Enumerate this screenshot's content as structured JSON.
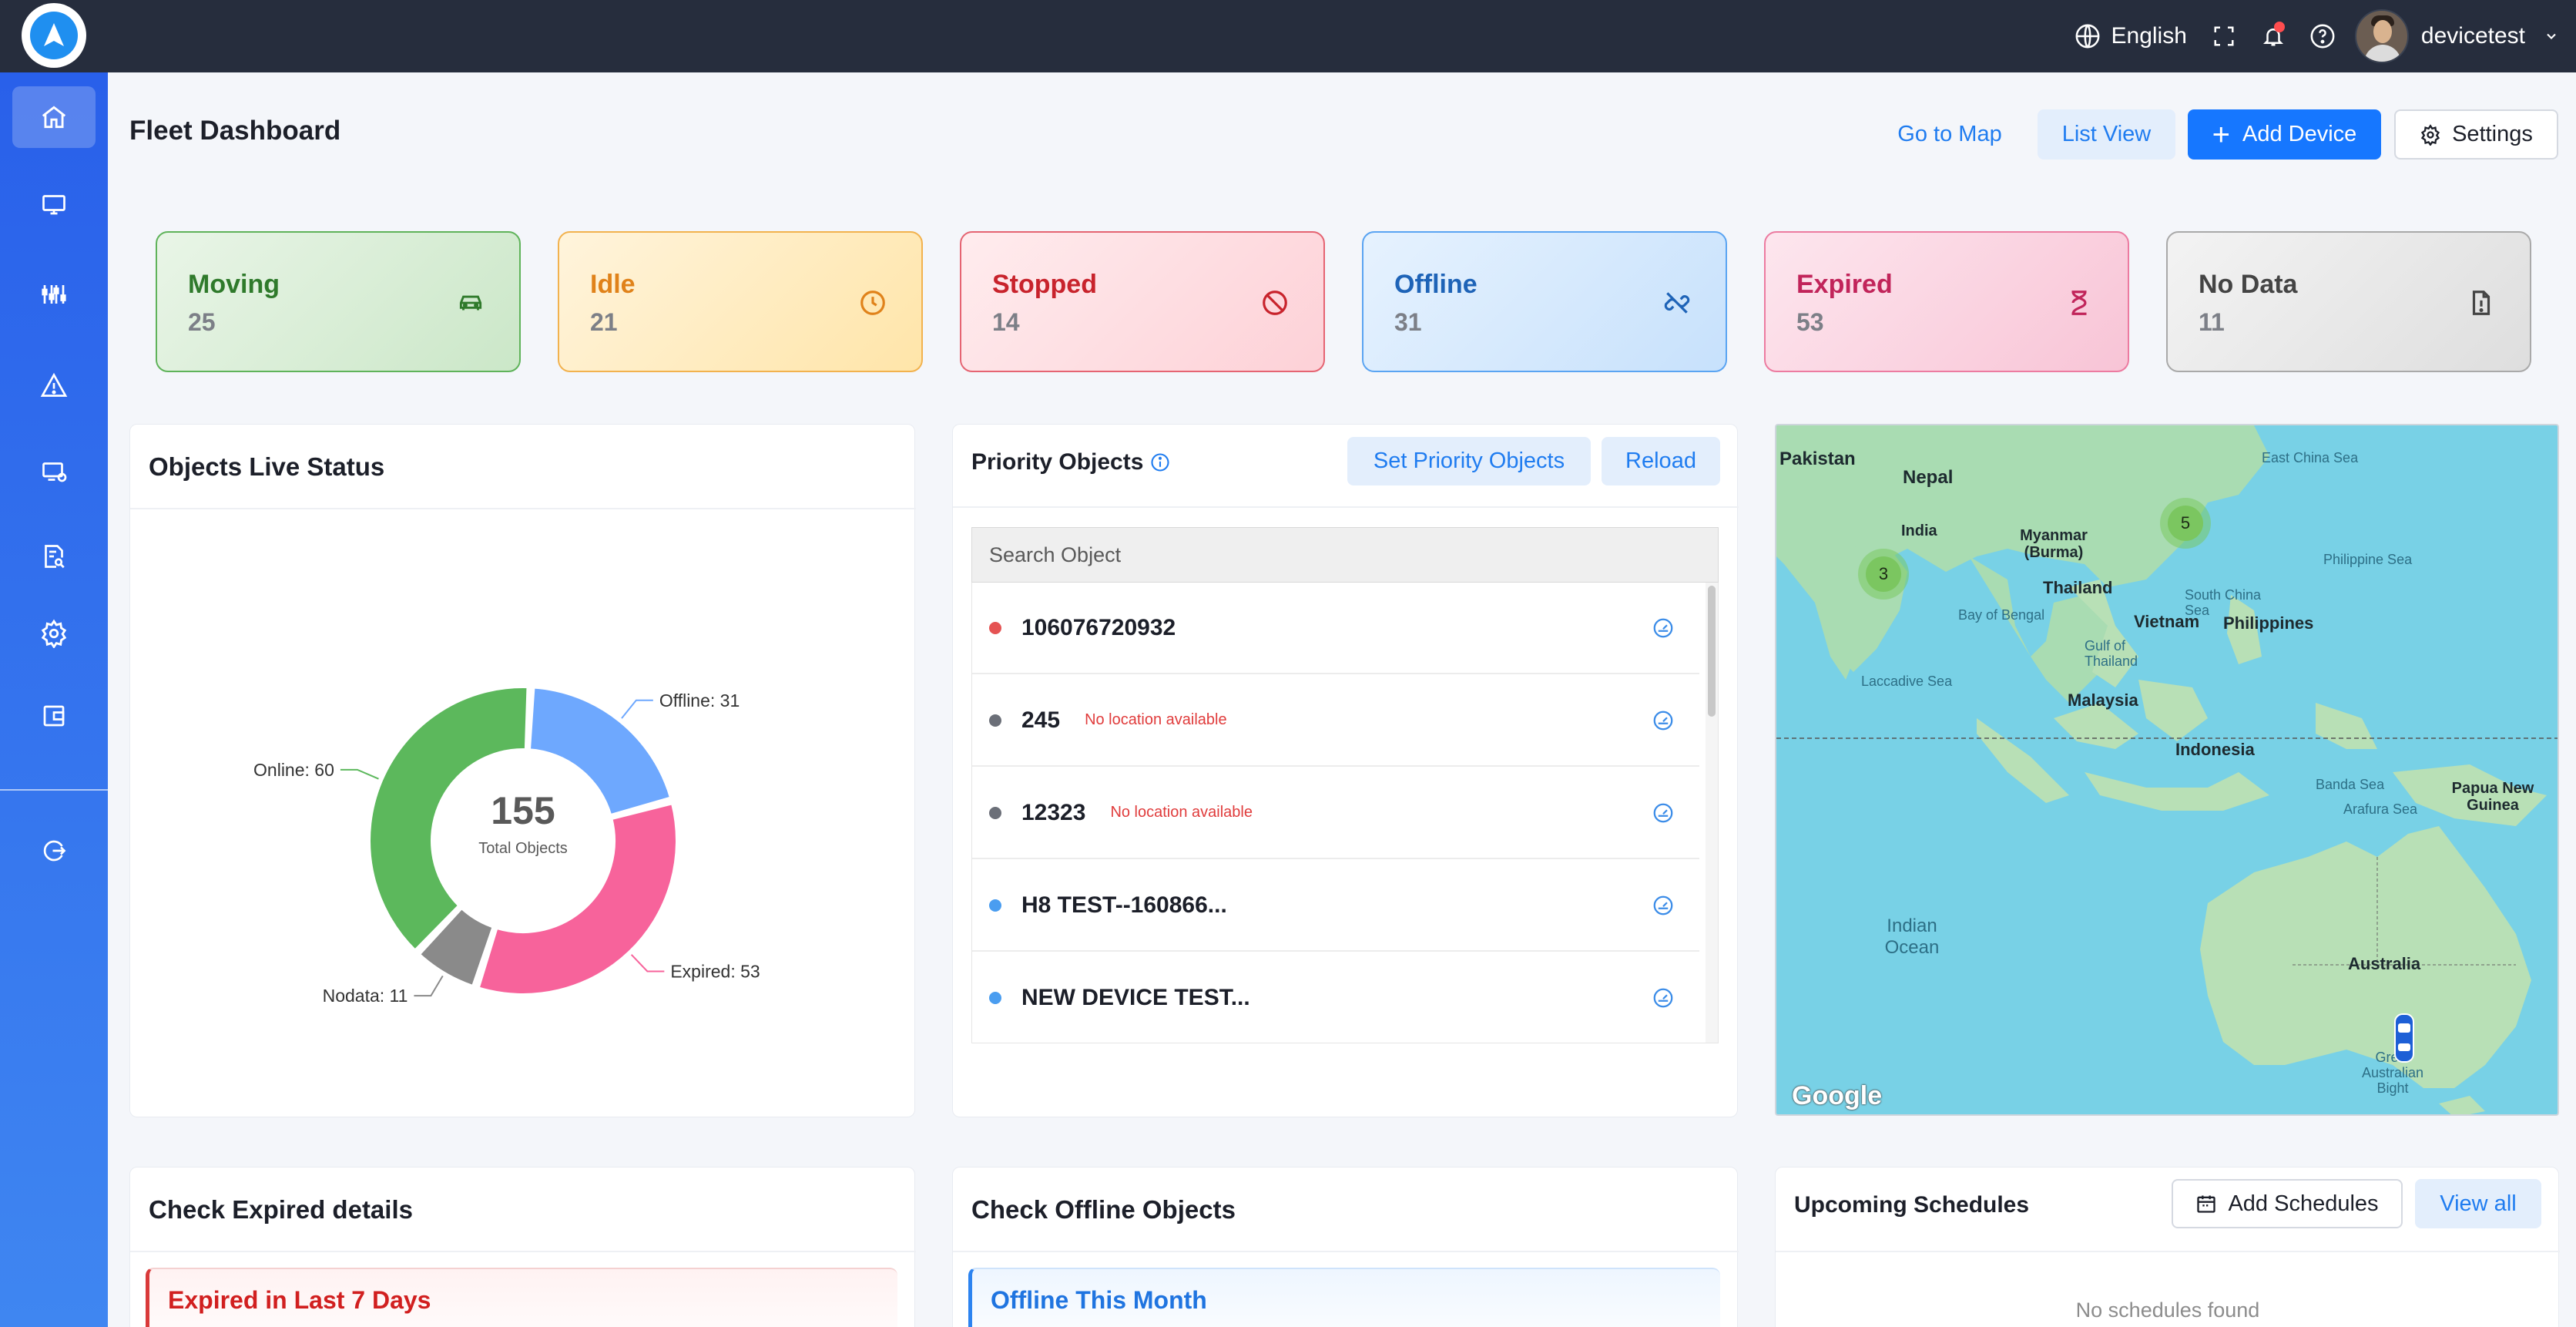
{
  "topbar": {
    "language": "English",
    "username": "devicetest"
  },
  "sidebar": {
    "items": [
      {
        "icon": "home-icon",
        "active": true
      },
      {
        "icon": "monitor-icon"
      },
      {
        "icon": "sliders-icon"
      },
      {
        "icon": "alert-triangle-icon"
      },
      {
        "icon": "screen-settings-icon"
      },
      {
        "icon": "report-search-icon"
      },
      {
        "icon": "gear-icon"
      },
      {
        "icon": "wallet-icon"
      },
      {
        "icon": "logout-icon"
      }
    ]
  },
  "header": {
    "title": "Fleet Dashboard",
    "go_to_map": "Go to Map",
    "list_view": "List View",
    "add_device": "Add Device",
    "settings": "Settings"
  },
  "status_cards": [
    {
      "label": "Moving",
      "value": "25",
      "icon": "car-icon",
      "color": "#2f7a2b"
    },
    {
      "label": "Idle",
      "value": "21",
      "icon": "clock-icon",
      "color": "#e0821a"
    },
    {
      "label": "Stopped",
      "value": "14",
      "icon": "ban-icon",
      "color": "#c8232c"
    },
    {
      "label": "Offline",
      "value": "31",
      "icon": "unlink-icon",
      "color": "#1e63b7"
    },
    {
      "label": "Expired",
      "value": "53",
      "icon": "hourglass-icon",
      "color": "#c1245a"
    },
    {
      "label": "No Data",
      "value": "11",
      "icon": "file-alert-icon",
      "color": "#444444"
    }
  ],
  "live_status": {
    "title": "Objects Live Status",
    "total": "155",
    "total_label": "Total Objects"
  },
  "chart_data": {
    "type": "pie",
    "donut": true,
    "center_value": "155",
    "center_label": "Total Objects",
    "slices": [
      {
        "name": "Offline",
        "value": 31,
        "label": "Offline: 31",
        "color": "#6ea8fe"
      },
      {
        "name": "Expired",
        "value": 53,
        "label": "Expired: 53",
        "color": "#f7639b"
      },
      {
        "name": "Nodata",
        "value": 11,
        "label": "Nodata: 11",
        "color": "#8a8a8a"
      },
      {
        "name": "Online",
        "value": 60,
        "label": "Online: 60",
        "color": "#5cb85c"
      }
    ]
  },
  "priority": {
    "title": "Priority Objects",
    "set_button": "Set Priority Objects",
    "reload_button": "Reload",
    "search_placeholder": "Search Object",
    "items": [
      {
        "name": "106076720932",
        "note": "",
        "dot_color": "#e55353"
      },
      {
        "name": "245",
        "note": "No location available",
        "dot_color": "#6b6f78"
      },
      {
        "name": "12323",
        "note": "No location available",
        "dot_color": "#6b6f78"
      },
      {
        "name": "H8 TEST--160866...",
        "note": "",
        "dot_color": "#4a9df0"
      },
      {
        "name": "NEW DEVICE TEST...",
        "note": "",
        "dot_color": "#4a9df0"
      }
    ]
  },
  "map": {
    "countries": [
      "Pakistan",
      "Nepal",
      "India",
      "Myanmar (Burma)",
      "Thailand",
      "Vietnam",
      "Philippines",
      "Malaysia",
      "Indonesia",
      "Papua New Guinea",
      "Australia"
    ],
    "seas": [
      "East China Sea",
      "Philippine Sea",
      "South China Sea",
      "Bay of Bengal",
      "Gulf of Thailand",
      "Laccadive Sea",
      "Banda Sea",
      "Arafura Sea",
      "Indian Ocean",
      "Great Australian Bight"
    ],
    "clusters": [
      "3",
      "5"
    ],
    "attribution": "Google"
  },
  "expired_panel": {
    "title": "Check Expired details",
    "card": "Expired in Last 7 Days"
  },
  "offline_panel": {
    "title": "Check Offline Objects",
    "card": "Offline This Month"
  },
  "schedules": {
    "title": "Upcoming Schedules",
    "add_button": "Add Schedules",
    "view_all": "View all",
    "empty": "No schedules found"
  }
}
